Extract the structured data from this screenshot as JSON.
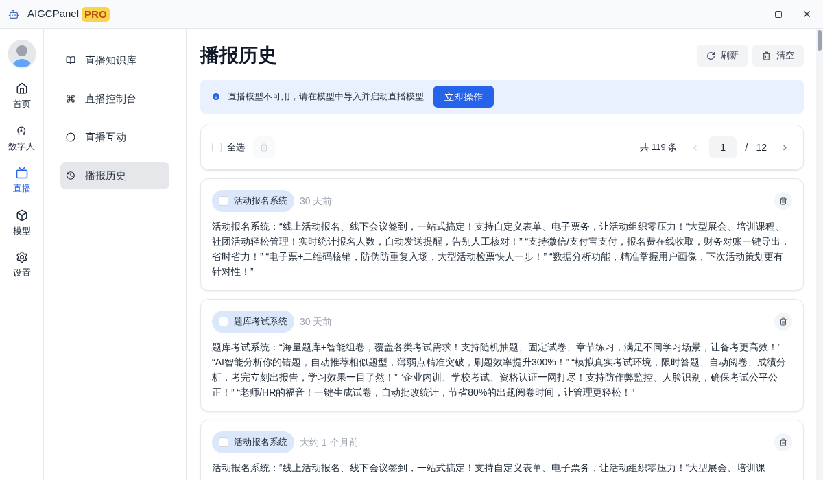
{
  "window": {
    "title": "AIGCPanel",
    "badge": "PRO"
  },
  "rail": [
    {
      "label": "首页",
      "selected": false
    },
    {
      "label": "数字人",
      "selected": false
    },
    {
      "label": "直播",
      "selected": true
    },
    {
      "label": "模型",
      "selected": false
    },
    {
      "label": "设置",
      "selected": false
    }
  ],
  "submenu": [
    {
      "label": "直播知识库",
      "selected": false
    },
    {
      "label": "直播控制台",
      "selected": false
    },
    {
      "label": "直播互动",
      "selected": false
    },
    {
      "label": "播报历史",
      "selected": true
    }
  ],
  "page": {
    "title": "播报历史",
    "buttons": [
      {
        "label": "刷新"
      },
      {
        "label": "清空"
      }
    ]
  },
  "alert": {
    "message": "直播模型不可用，请在模型中导入并启动直播模型",
    "action": "立即操作"
  },
  "toolbar": {
    "select_all": {
      "label": "全选",
      "checked": false
    },
    "total": "共 119 条",
    "page": "1",
    "separator": "/",
    "pages": "12"
  },
  "records": [
    {
      "tag": "活动报名系统",
      "time": "30 天前",
      "checked": false,
      "text": "活动报名系统：“线上活动报名、线下会议签到，一站式搞定！支持自定义表单、电子票务，让活动组织零压力！“大型展会、培训课程、社团活动轻松管理！实时统计报名人数，自动发送提醒，告别人工核对！” “支持微信/支付宝支付，报名费在线收取，财务对账一键导出，省时省力！” “电子票+二维码核销，防伪防重复入场，大型活动检票快人一步！” “数据分析功能，精准掌握用户画像，下次活动策划更有针对性！”"
    },
    {
      "tag": "题库考试系统",
      "time": "30 天前",
      "checked": false,
      "text": "题库考试系统：“海量题库+智能组卷，覆盖各类考试需求！支持随机抽题、固定试卷、章节练习，满足不同学习场景，让备考更高效！” “AI智能分析你的错题，自动推荐相似题型，薄弱点精准突破，刷题效率提升300%！” “模拟真实考试环境，限时答题、自动阅卷、成绩分析，考完立刻出报告，学习效果一目了然！” “企业内训、学校考试、资格认证一网打尽！支持防作弊监控、人脸识别，确保考试公平公正！” “老师/HR的福音！一键生成试卷，自动批改统计，节省80%的出题阅卷时间，让管理更轻松！”"
    },
    {
      "tag": "活动报名系统",
      "time": "大约 1 个月前",
      "checked": false,
      "text": "活动报名系统：“线上活动报名、线下会议签到，一站式搞定！支持自定义表单、电子票务，让活动组织零压力！“大型展会、培训课"
    }
  ]
}
